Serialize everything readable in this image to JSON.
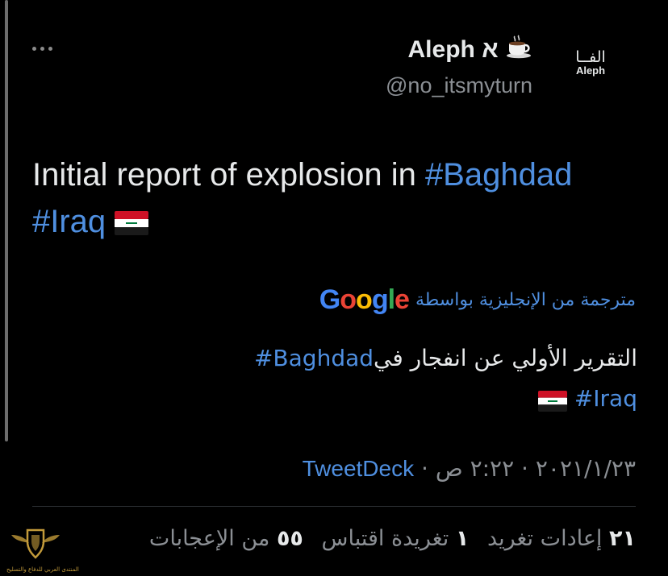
{
  "tweet": {
    "author": {
      "display_name": "Aleph א",
      "emoji": "☕",
      "handle": "@no_itsmyturn",
      "avatar_text_arabic": "الفــا",
      "avatar_text_latin": "Aleph"
    },
    "text": {
      "prefix": "Initial report of explosion in ",
      "hashtag1": "#Baghdad",
      "hashtag2": "#Iraq",
      "flag": "iraq-flag"
    },
    "translation": {
      "label": "مترجمة من الإنجليزية بواسطة",
      "provider": "Google",
      "text": "التقرير الأولي عن انفجار في",
      "hashtag1": "#Baghdad",
      "hashtag2": "#Iraq"
    },
    "meta": {
      "time": "٢:٢٢ ص",
      "date": "٢٠٢١/١/٢٣",
      "separator": "·",
      "source": "TweetDeck"
    },
    "stats": {
      "retweets_count": "٢١",
      "retweets_label": "إعادات تغريد",
      "quotes_count": "١",
      "quotes_label": "تغريدة اقتباس",
      "likes_count": "٥٥",
      "likes_label": "من الإعجابات"
    }
  },
  "watermark": {
    "text": "المنتدى العربي للدفاع والتسليح"
  },
  "colors": {
    "background": "#000000",
    "text": "#e7e9ea",
    "secondary": "#8b8f94",
    "link": "#4f8fe0",
    "flag_red": "#ce1126",
    "flag_green": "#007a3d",
    "watermark_gold": "#c29a3a"
  }
}
